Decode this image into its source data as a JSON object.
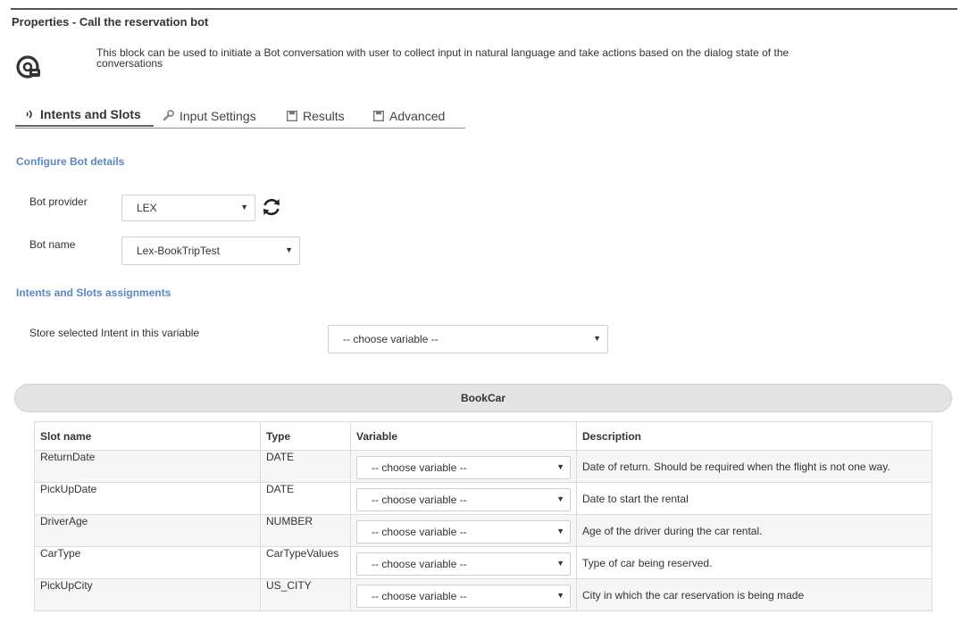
{
  "header": {
    "title": "Properties - Call the reservation bot"
  },
  "description": "This block can be used to initiate a Bot conversation with user to collect input in natural language and take actions based on the dialog state of the conversations",
  "tabs": [
    {
      "label": "Intents and Slots",
      "icon": "sound-wave-icon",
      "active": true
    },
    {
      "label": "Input Settings",
      "icon": "wrench-icon",
      "active": false
    },
    {
      "label": "Results",
      "icon": "floppy-disk-icon",
      "active": false
    },
    {
      "label": "Advanced",
      "icon": "floppy-disk-icon",
      "active": false
    }
  ],
  "configure": {
    "section_title": "Configure Bot details",
    "provider_label": "Bot provider",
    "provider_value": "LEX",
    "bot_name_label": "Bot name",
    "bot_name_value": "Lex-BookTripTest"
  },
  "intents": {
    "section_title": "Intents and Slots assignments",
    "store_label": "Store selected Intent in this variable",
    "store_value": "-- choose variable --"
  },
  "intent_panel": {
    "name": "BookCar"
  },
  "slots_table": {
    "columns": [
      "Slot name",
      "Type",
      "Variable",
      "Description"
    ],
    "rows": [
      {
        "slot": "ReturnDate",
        "type": "DATE",
        "variable": "-- choose variable --",
        "description": "Date of return. Should be required when the flight is not one way."
      },
      {
        "slot": "PickUpDate",
        "type": "DATE",
        "variable": "-- choose variable --",
        "description": "Date to start the rental"
      },
      {
        "slot": "DriverAge",
        "type": "NUMBER",
        "variable": "-- choose variable --",
        "description": "Age of the driver during the car rental."
      },
      {
        "slot": "CarType",
        "type": "CarTypeValues",
        "variable": "-- choose variable --",
        "description": "Type of car being reserved."
      },
      {
        "slot": "PickUpCity",
        "type": "US_CITY",
        "variable": "-- choose variable --",
        "description": "City in which the car reservation is being made"
      }
    ]
  },
  "colors": {
    "section_heading": "#5b87c0",
    "panel_bg": "#e4e4e4"
  }
}
